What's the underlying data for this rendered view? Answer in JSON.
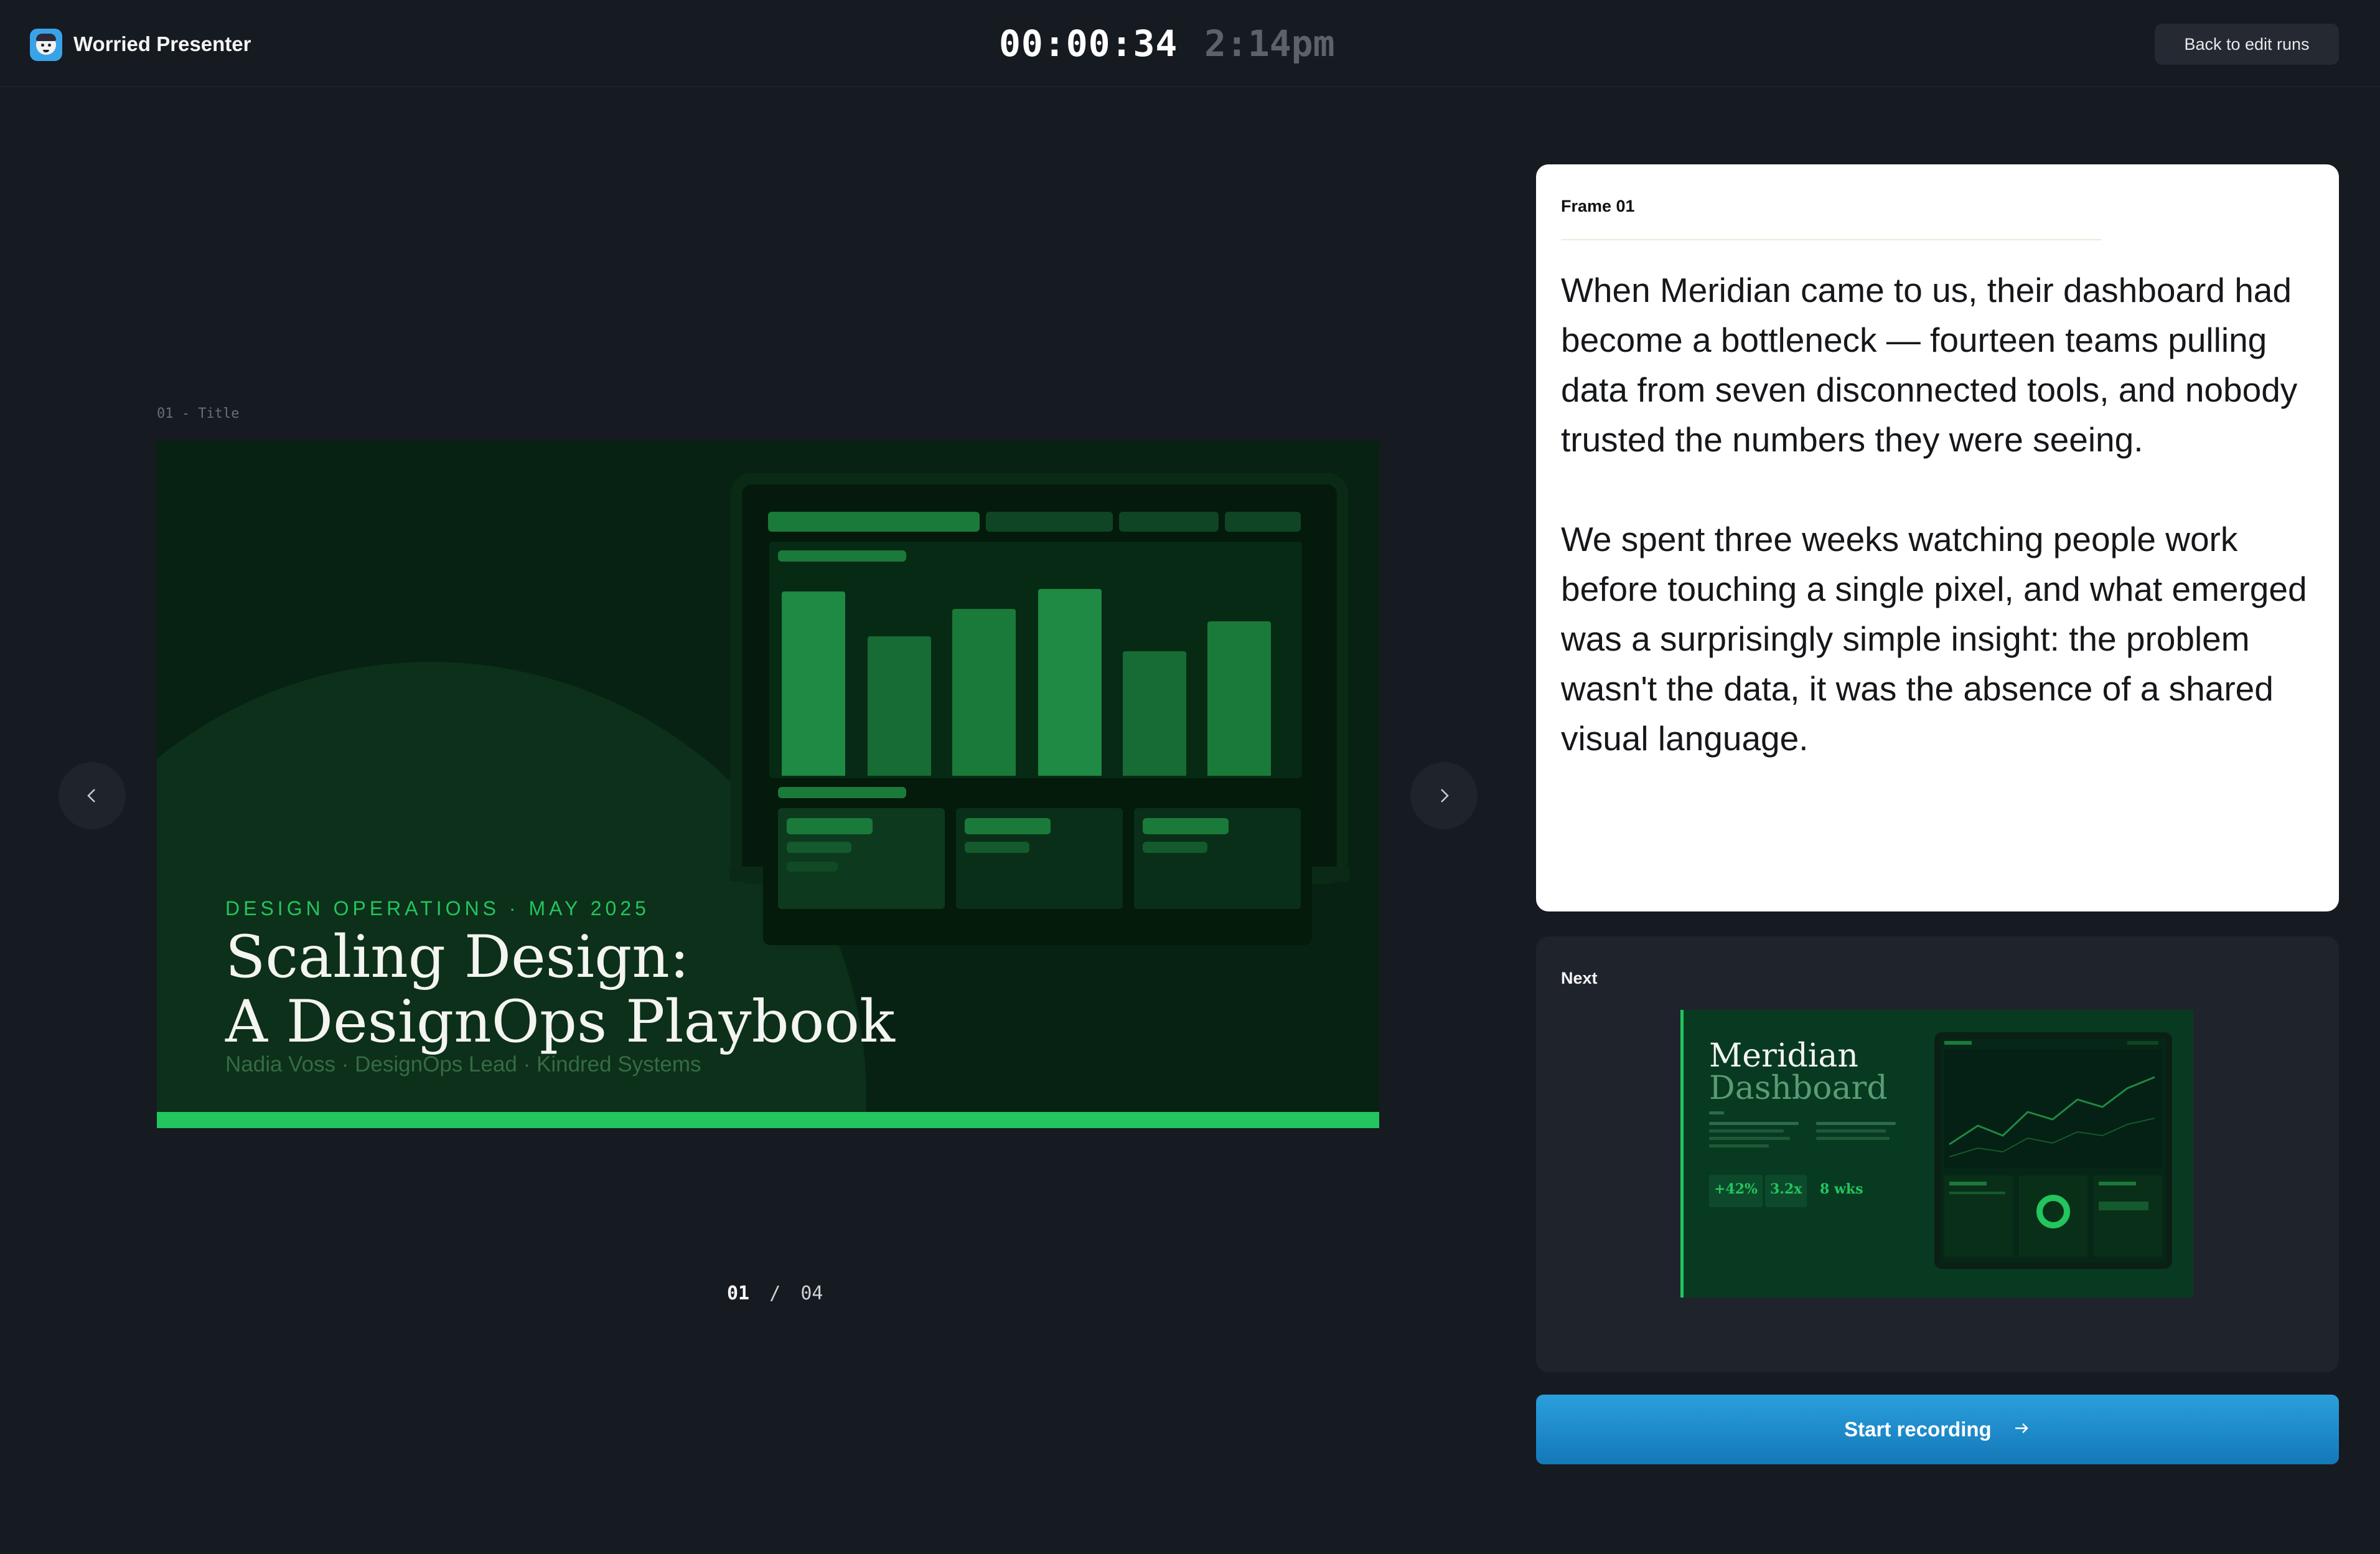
{
  "app": {
    "name": "Worried Presenter",
    "logo_icon": "worried-face-icon"
  },
  "header": {
    "elapsed": "00:00:34",
    "clock": "2:14pm",
    "back_label": "Back to edit runs"
  },
  "current_slide": {
    "label": "01 - Title",
    "kicker": "DESIGN OPERATIONS · MAY 2025",
    "title_line1": "Scaling Design:",
    "title_line2": "A DesignOps Playbook",
    "subtitle": "Nadia Voss · DesignOps Lead · Kindred Systems",
    "accent_color": "#22c55e",
    "background_color": "#072212"
  },
  "navigation": {
    "prev_icon": "chevron-left-icon",
    "next_icon": "chevron-right-icon"
  },
  "counter": {
    "current": "01",
    "separator": "/",
    "total": "04"
  },
  "notes": {
    "frame_label": "Frame 01",
    "paragraph1": "When Meridian came to us, their dashboard had become a bottleneck — fourteen teams pulling data from seven disconnected tools, and nobody trusted the numbers they were seeing.",
    "paragraph2": "We spent three weeks watching people work before touching a single pixel, and what emerged was a surprisingly simple insight: the problem wasn't the data, it was the absence of a shared visual language."
  },
  "next": {
    "label": "Next",
    "title_line1": "Meridian",
    "title_line2": "Dashboard",
    "stats": [
      "+42%",
      "3.2x",
      "8 wks"
    ]
  },
  "actions": {
    "start_label": "Start recording",
    "start_icon": "arrow-right-icon",
    "start_color": "#1f8fcf"
  }
}
